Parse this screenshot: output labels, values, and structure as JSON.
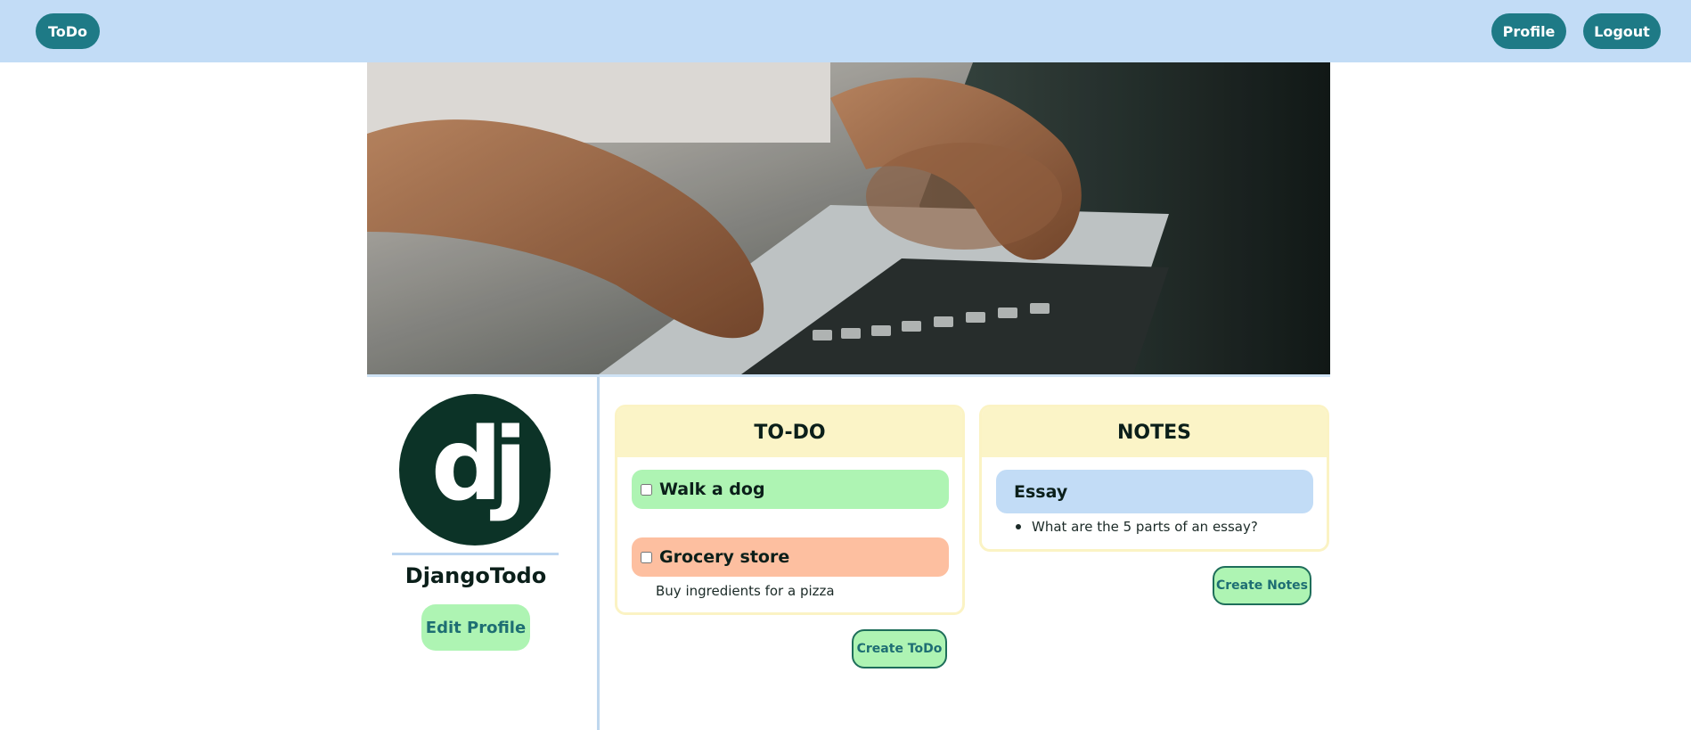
{
  "nav": {
    "brand": "ToDo",
    "profile": "Profile",
    "logout": "Logout"
  },
  "user": {
    "avatar_text": "dj",
    "name": "DjangoTodo",
    "edit_profile": "Edit Profile"
  },
  "todo": {
    "header": "TO-DO",
    "items": [
      {
        "title": "Walk a dog",
        "color": "#aef4b3",
        "checked": false,
        "description": ""
      },
      {
        "title": "Grocery store",
        "color": "#fdbfa0",
        "checked": false,
        "description": "Buy ingredients for a pizza"
      }
    ],
    "create_label": "Create ToDo"
  },
  "notes": {
    "header": "NOTES",
    "items": [
      {
        "title": "Essay",
        "color": "#c2dcf6",
        "bullets": [
          "What are the 5 parts of an essay?"
        ]
      }
    ],
    "create_label": "Create Notes"
  },
  "colors": {
    "nav_bg": "#c2dcf6",
    "accent": "#1e7a86",
    "card_header": "#fbf4c7",
    "button_green": "#aef4b3"
  },
  "hero_image": {
    "icon": "laptop-typing-photo"
  }
}
